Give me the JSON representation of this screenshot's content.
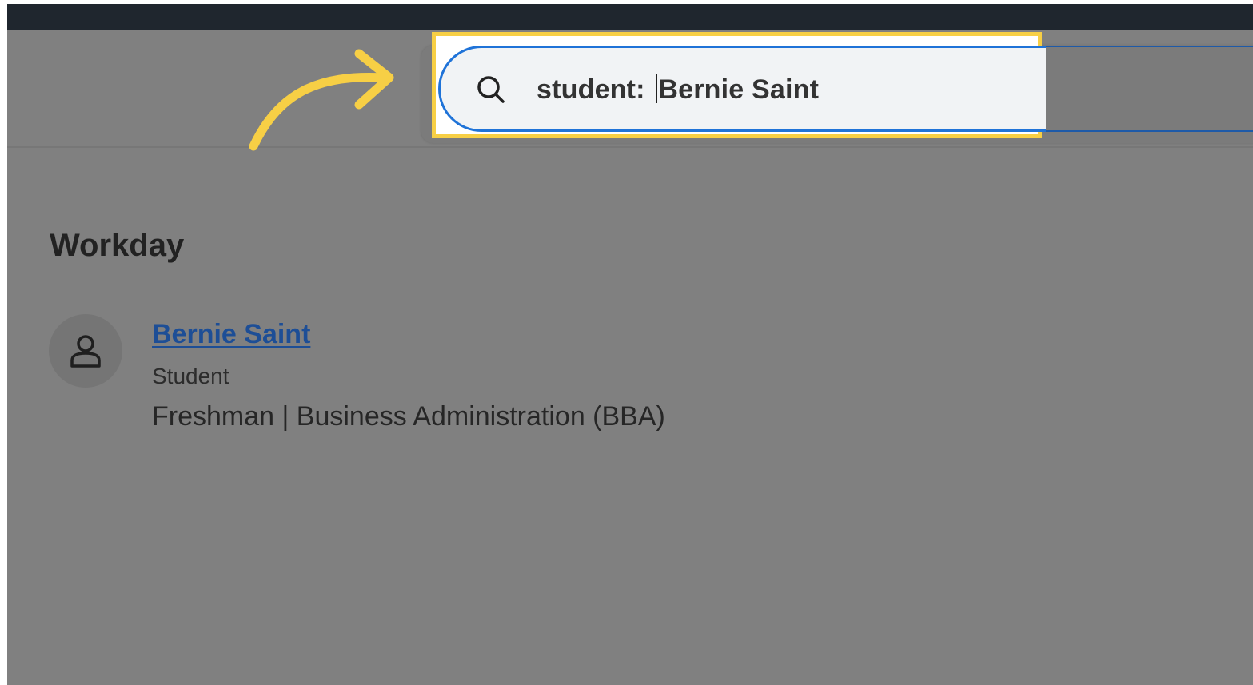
{
  "search": {
    "query_prefix": "student: ",
    "query_term": "Bernie Saint"
  },
  "results": {
    "section_title": "Workday",
    "items": [
      {
        "name": "Bernie Saint",
        "type": "Student",
        "detail": "Freshman | Business Administration (BBA)",
        "icon": "user-icon"
      }
    ]
  },
  "colors": {
    "top_bar": "#1f262e",
    "overlay": "#808080",
    "highlight": "#f7cf45",
    "link": "#1d4e96",
    "search_border": "#1f73d8"
  }
}
